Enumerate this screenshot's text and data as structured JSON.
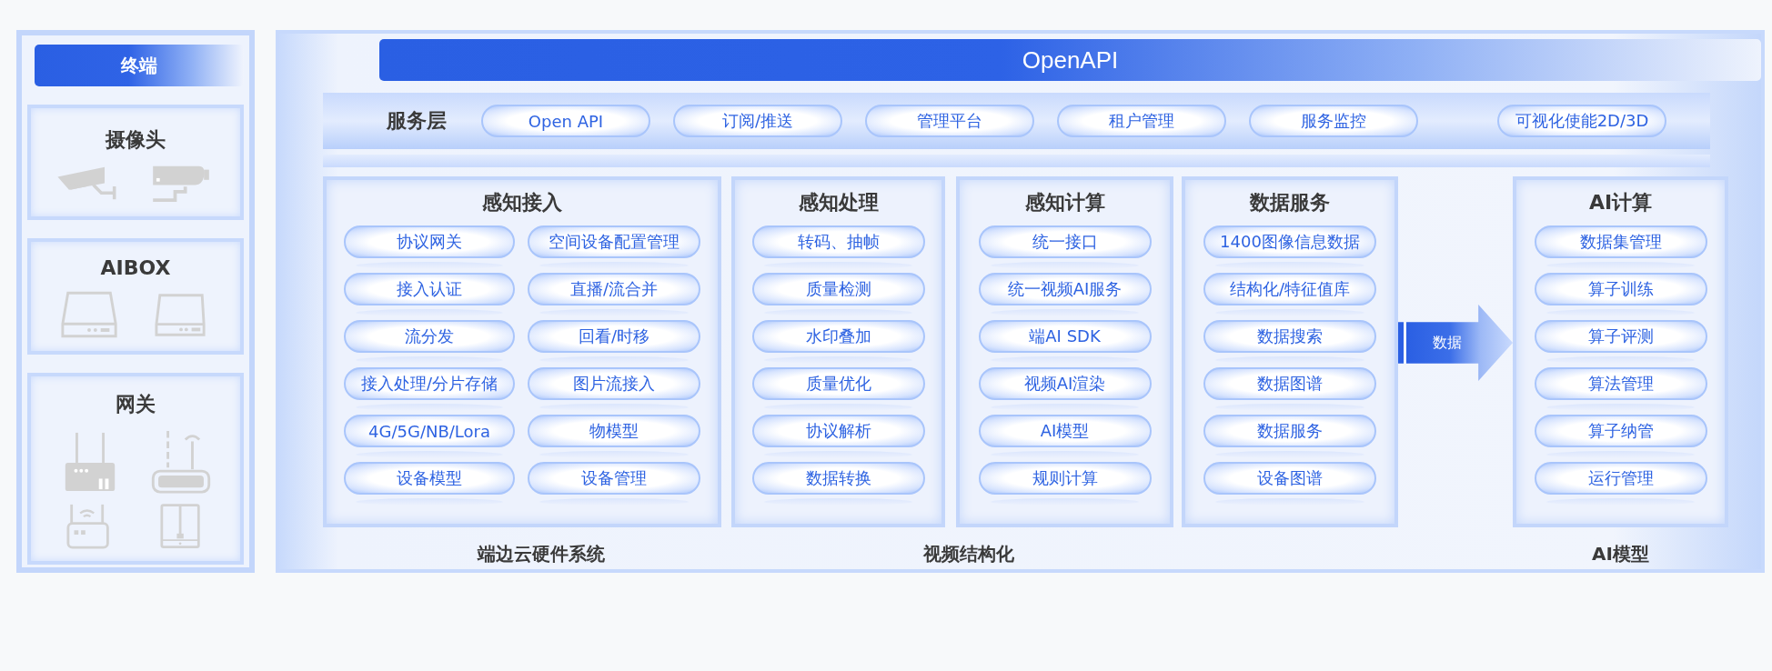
{
  "terminal": {
    "title": "终端",
    "groups": [
      {
        "title": "摄像头",
        "kind": "camera"
      },
      {
        "title": "AIBOX",
        "kind": "box"
      },
      {
        "title": "网关",
        "kind": "gateway"
      }
    ]
  },
  "architecture": {
    "banner": "OpenAPI",
    "service_layer": {
      "title": "服务层",
      "items": [
        "Open API",
        "订阅/推送",
        "管理平台",
        "租户管理",
        "服务监控",
        "可视化使能2D/3D"
      ]
    },
    "modules": [
      {
        "title": "感知接入",
        "kind": "wide",
        "items": [
          "协议网关",
          "空间设备配置管理",
          "接入认证",
          "直播/流合并",
          "流分发",
          "回看/时移",
          "接入处理/分片存储",
          "图片流接入",
          "4G/5G/NB/Lora",
          "物模型",
          "设备模型",
          "设备管理"
        ]
      },
      {
        "title": "感知处理",
        "kind": "narrow",
        "items": [
          "转码、抽帧",
          "质量检测",
          "水印叠加",
          "质量优化",
          "协议解析",
          "数据转换"
        ]
      },
      {
        "title": "感知计算",
        "kind": "narrow",
        "items": [
          "统一接口",
          "统一视频AI服务",
          "端AI SDK",
          "视频AI渲染",
          "AI模型",
          "规则计算"
        ]
      },
      {
        "title": "数据服务",
        "kind": "narrow",
        "items": [
          "1400图像信息数据",
          "结构化/特征值库",
          "数据搜索",
          "数据图谱",
          "数据服务",
          "设备图谱"
        ]
      }
    ],
    "flow_arrow": {
      "label": "数据"
    },
    "ai_module": {
      "title": "AI计算",
      "items": [
        "数据集管理",
        "算子训练",
        "算子评测",
        "算法管理",
        "算子纳管",
        "运行管理"
      ]
    },
    "footer_labels": [
      "端边云硬件系统",
      "视频结构化",
      "AI模型"
    ]
  }
}
